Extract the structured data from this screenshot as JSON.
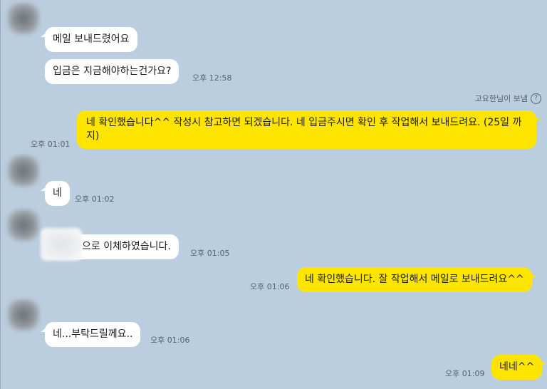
{
  "messages": [
    {
      "text": "메일 보내드렸어요"
    },
    {
      "text": "입금은 지금해야하는건가요?",
      "time": "오후 12:58"
    },
    {
      "text": "네 확인했습니다^^ 작성시 참고하면 되겠습니다. 네 입금주시면 확인 후 작업해서 보내드려요. (25일 까지)",
      "time": "오후 01:01",
      "read_label": "고요한님이 보냄"
    },
    {
      "text": "네",
      "time": "오후 01:02"
    },
    {
      "text": "으로 이체하였습니다.",
      "time": "오후 01:05"
    },
    {
      "text": "네 확인했습니다. 잘 작업해서 메일로 보내드려요^^",
      "time": "오후 01:06"
    },
    {
      "text": "네...부탁드릴께요..",
      "time": "오후 01:06"
    },
    {
      "text": "네네^^",
      "time": "오후 01:09"
    }
  ],
  "icons": {
    "help": "question-circle-icon",
    "avatar": "blurred-profile-avatar"
  },
  "colors": {
    "background": "#bacee0",
    "incoming_bubble": "#ffffff",
    "outgoing_bubble": "#fee500"
  }
}
